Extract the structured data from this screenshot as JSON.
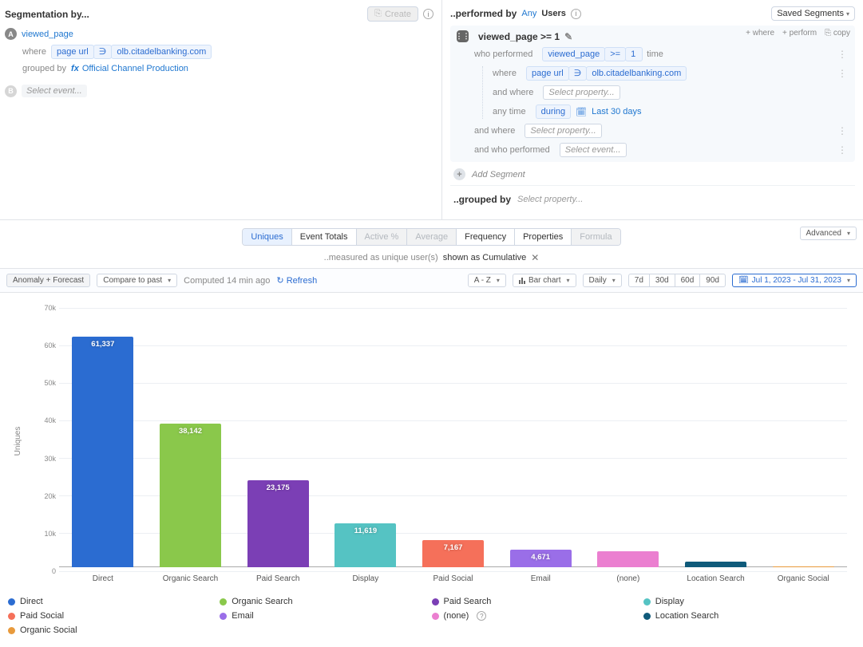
{
  "left": {
    "title": "Segmentation by...",
    "create_label": "Create",
    "event_a": {
      "name": "viewed_page",
      "where_label": "where",
      "where_prop": "page url",
      "where_op": "∋",
      "where_val": "olb.citadelbanking.com",
      "grouped_label": "grouped by",
      "grouped_val": "Official Channel Production"
    },
    "event_b_placeholder": "Select event..."
  },
  "right": {
    "performed_by_label": "..performed by",
    "performed_any": "Any",
    "users": "Users",
    "saved_segments": "Saved Segments",
    "segment": {
      "title": "viewed_page >= 1",
      "actions": {
        "where": "+ where",
        "perform": "+ perform",
        "copy": "copy"
      },
      "who_label": "who performed",
      "who_event": "viewed_page",
      "who_op": ">=",
      "who_val": "1",
      "who_unit": "time",
      "nested_where_label": "where",
      "nested_where_prop": "page url",
      "nested_where_op": "∋",
      "nested_where_val": "olb.citadelbanking.com",
      "and_where_label": "and where",
      "select_property": "Select property...",
      "any_time": "any time",
      "during": "during",
      "last30": "Last 30 days",
      "and_where2": "and where",
      "who_performed2": "and who performed",
      "select_event": "Select event..."
    },
    "add_segment": "Add Segment",
    "grouped_by_label": "..grouped by",
    "grouped_by_placeholder": "Select property..."
  },
  "mid": {
    "tabs": [
      "Uniques",
      "Event Totals",
      "Active %",
      "Average",
      "Frequency",
      "Properties",
      "Formula"
    ],
    "advanced": "Advanced",
    "measure_pre": "..measured as unique user(s)",
    "measure_post": "shown as Cumulative"
  },
  "toolbar": {
    "anomaly": "Anomaly + Forecast",
    "compare": "Compare to past",
    "computed": "Computed 14 min ago",
    "refresh": "Refresh",
    "sort": "A - Z",
    "barchart": "Bar chart",
    "daily": "Daily",
    "ranges": [
      "7d",
      "30d",
      "60d",
      "90d"
    ],
    "date": "Jul 1, 2023 - Jul 31, 2023"
  },
  "chart_data": {
    "type": "bar",
    "ylabel": "Uniques",
    "ylim": [
      0,
      70000
    ],
    "y_ticks": [
      "0",
      "10k",
      "20k",
      "30k",
      "40k",
      "50k",
      "60k",
      "70k"
    ],
    "categories": [
      "Direct",
      "Organic Search",
      "Paid Search",
      "Display",
      "Paid Social",
      "Email",
      "(none)",
      "Location Search",
      "Organic Social"
    ],
    "values": [
      61337,
      38142,
      23175,
      11619,
      7167,
      4671,
      4200,
      1500,
      300
    ],
    "value_labels": [
      "61,337",
      "38,142",
      "23,175",
      "11,619",
      "7,167",
      "4,671",
      "",
      "",
      ""
    ],
    "colors": [
      "#2b6cd1",
      "#8ac84b",
      "#7b3fb5",
      "#55c3c3",
      "#f5705a",
      "#9a6ee8",
      "#eb7fd0",
      "#0f5a7a",
      "#e89a3c"
    ]
  },
  "legend": {
    "row1": [
      {
        "label": "Direct",
        "color": "#2b6cd1"
      },
      {
        "label": "Organic Search",
        "color": "#8ac84b"
      },
      {
        "label": "Paid Search",
        "color": "#7b3fb5"
      },
      {
        "label": "Display",
        "color": "#55c3c3"
      }
    ],
    "row2": [
      {
        "label": "Paid Social",
        "color": "#f5705a"
      },
      {
        "label": "Email",
        "color": "#9a6ee8"
      },
      {
        "label": "(none)",
        "color": "#eb7fd0",
        "help": true
      },
      {
        "label": "Location Search",
        "color": "#0f5a7a"
      }
    ],
    "row3": [
      {
        "label": "Organic Social",
        "color": "#e89a3c"
      }
    ]
  }
}
